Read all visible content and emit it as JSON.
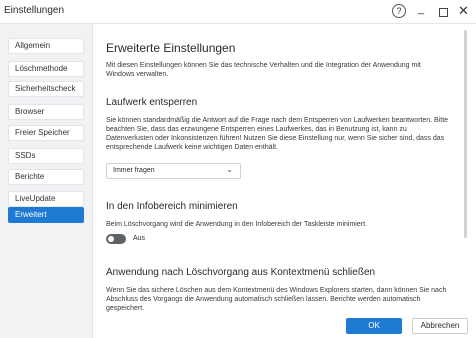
{
  "window": {
    "title": "Einstellungen",
    "help_glyph": "?",
    "minimize_glyph": "_",
    "close_glyph": "✕"
  },
  "sidebar": {
    "items": [
      {
        "label": "Allgemein",
        "active": false
      },
      {
        "label": "Löschmethode",
        "active": false
      },
      {
        "label": "Sicherheitscheck",
        "active": false
      },
      {
        "label": "Browser",
        "active": false
      },
      {
        "label": "Freier Speicher",
        "active": false
      },
      {
        "label": "SSDs",
        "active": false
      },
      {
        "label": "Berichte",
        "active": false
      },
      {
        "label": "LiveUpdate",
        "active": false
      },
      {
        "label": "Erweitert",
        "active": true
      }
    ]
  },
  "main": {
    "title": "Erweiterte Einstellungen",
    "intro": "Mit diesen Einstellungen können Sie das technische Verhalten und die Integration der Anwendung mit Windows verwalten.",
    "sections": [
      {
        "heading": "Laufwerk entsperren",
        "description": "Sie können standardmäßig die Antwort auf die Frage nach dem Entsperren von Laufwerken beantworten. Bitte beachten Sie, dass das erzwungene Entsperren eines Laufwerkes, das in Benutzung ist, kann zu Datenverlusten oder Inkonsistenzen führen! Nutzen Sie diese Einstellung nur, wenn Sie sicher sind, dass das entsprechende Laufwerk keine wichtigen Daten enthält.",
        "select_value": "Immer fragen"
      },
      {
        "heading": "In den Infobereich minimieren",
        "description": "Beim Löschvorgang wird die Anwendung in den Infobereich der Taskleiste minimiert.",
        "toggle_label": "Aus",
        "toggle_on": false
      },
      {
        "heading": "Anwendung nach Löschvorgang aus Kontextmenü schließen",
        "description": "Wenn Sie das sichere Löschen aus dem Kontextmenü des Windows Explorers starten, dann können Sie nach Abschluss des Vorgangs die Anwendung automatisch schließen lassen. Berichte werden automatisch gespeichert."
      }
    ]
  },
  "footer": {
    "ok_label": "OK",
    "cancel_label": "Abbrechen"
  },
  "colors": {
    "accent": "#1f7ad1",
    "sidebar_bg": "#f1f2f4",
    "toggle_off": "#5f6368"
  },
  "icons": [
    "help-icon",
    "minimize-icon",
    "maximize-icon",
    "close-icon",
    "chevron-down-icon"
  ]
}
